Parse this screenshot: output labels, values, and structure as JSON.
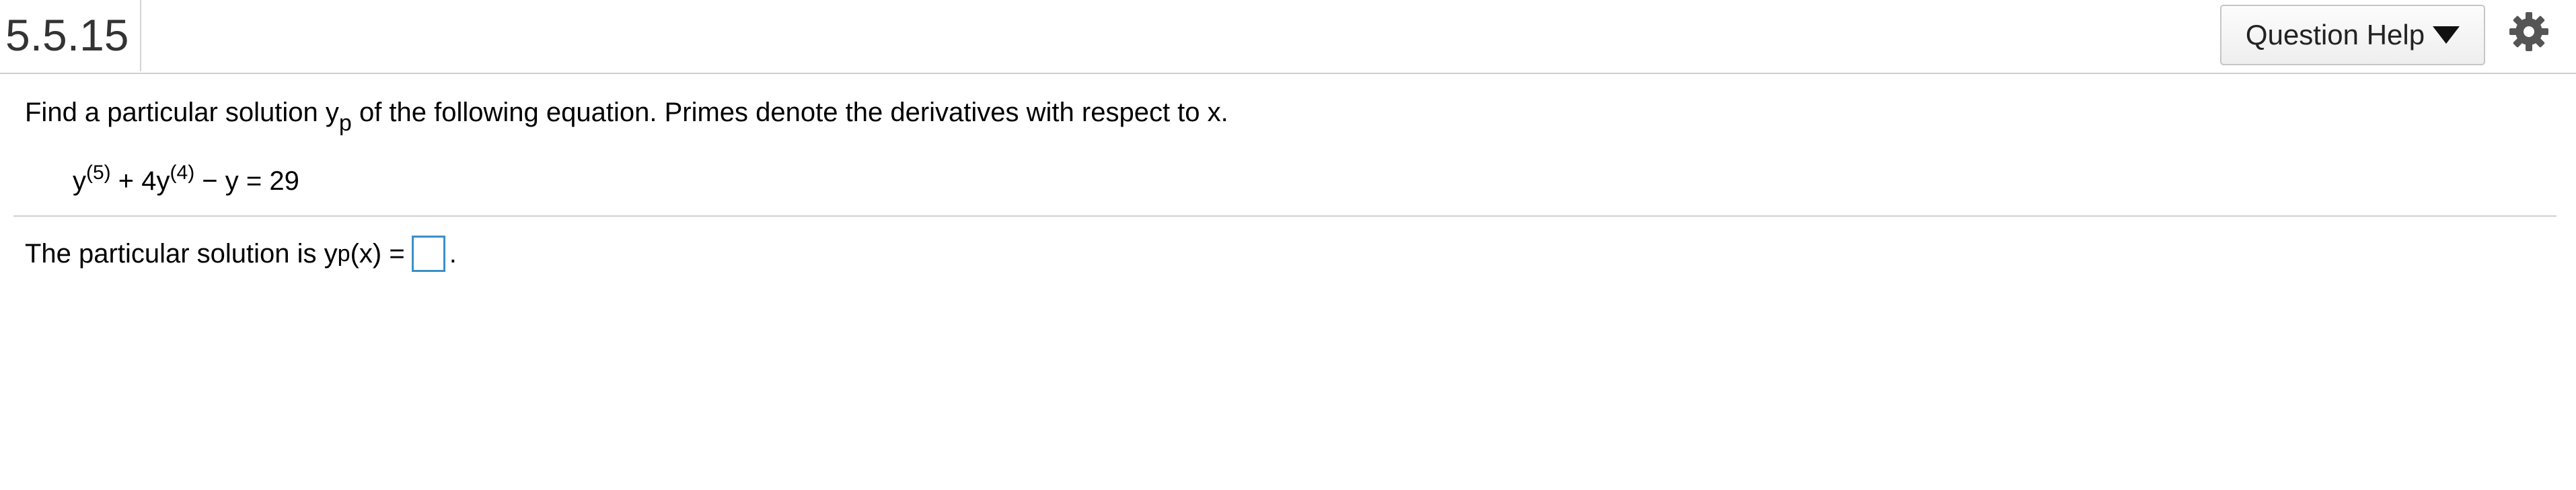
{
  "header": {
    "question_number": "5.5.15",
    "help_button_label": "Question Help",
    "icons": {
      "help_caret": "caret-down-icon",
      "settings": "gear-icon"
    }
  },
  "problem": {
    "intro_before": "Find a particular solution y",
    "intro_subscript": "p",
    "intro_after": " of the following equation. Primes denote the derivatives with respect to x.",
    "equation": {
      "term1_base": "y",
      "term1_order": "(5)",
      "term2_base": " + 4y",
      "term2_order": "(4)",
      "rest": " − y = 29"
    }
  },
  "answer": {
    "prefix": "The particular solution is y",
    "prefix_subscript": "p",
    "prefix_after": "(x) =",
    "suffix": "."
  },
  "colors": {
    "answer_box_border": "#3a8fc9",
    "divider": "#d0d0d0"
  }
}
